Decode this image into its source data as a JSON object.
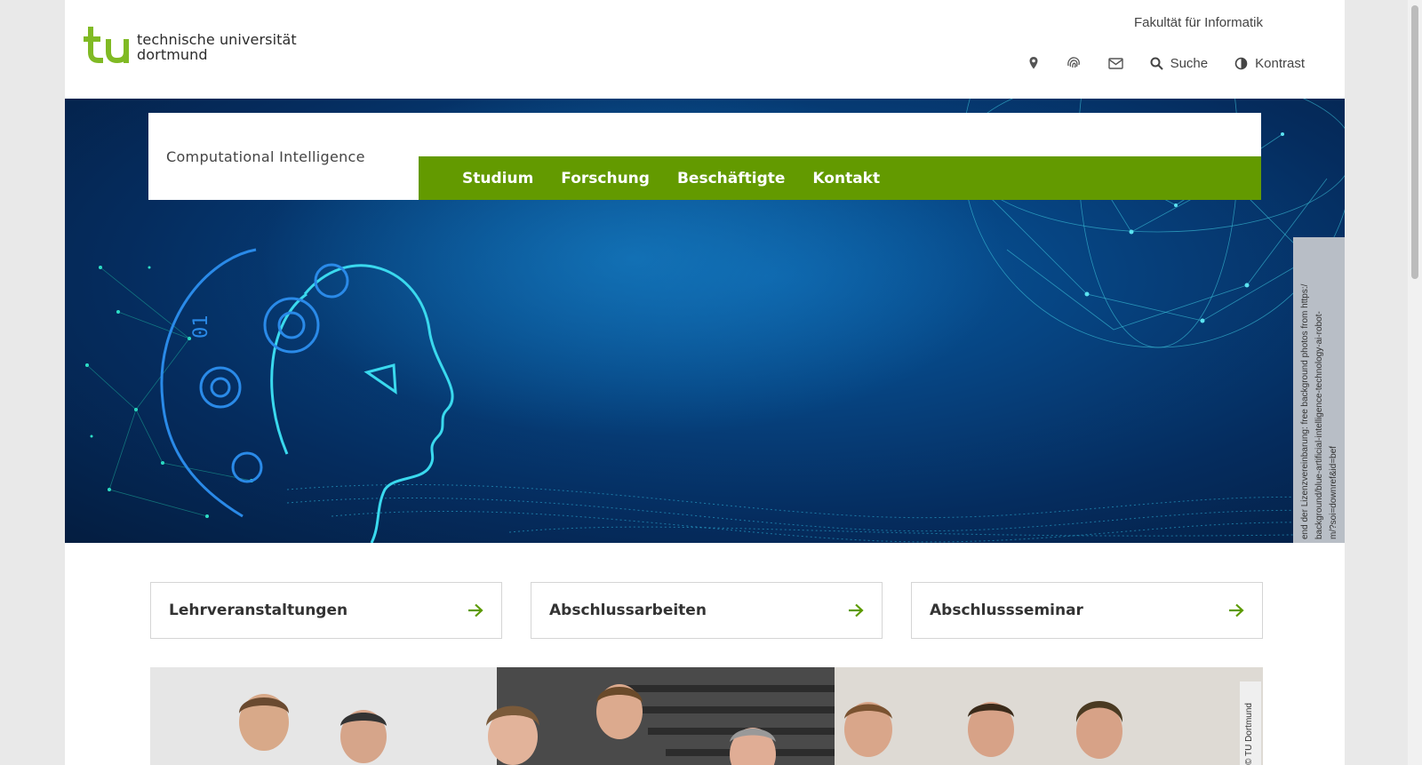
{
  "header": {
    "logo": {
      "line1": "technische universität",
      "line2": "dortmund",
      "mark": "tu"
    },
    "faculty_link": "Fakultät für Informatik",
    "utilities": [
      {
        "icon": "map-pin-icon",
        "label": ""
      },
      {
        "icon": "fingerprint-icon",
        "label": ""
      },
      {
        "icon": "mail-icon",
        "label": ""
      },
      {
        "icon": "search-icon",
        "label": "Suche"
      },
      {
        "icon": "contrast-icon",
        "label": "Kontrast"
      }
    ]
  },
  "hero": {
    "site_title": "Computational Intelligence",
    "nav": [
      "Studium",
      "Forschung",
      "Beschäftigte",
      "Kontakt"
    ],
    "image_credit_lines": [
      "end der Lizenzvereinbarung: free background photos from https:/",
      "background/blue-artificial-intelligence-technology-ai-robot-",
      "m/?soi=downref&id=bef"
    ]
  },
  "quicklinks": [
    "Lehrveranstaltungen",
    "Abschlussarbeiten",
    "Abschlussseminar"
  ],
  "photo": {
    "credit": "© TU Dortmund"
  },
  "colors": {
    "brand_green": "#639a00",
    "hero_blue": "#064583",
    "accent_cyan": "#38d5e6"
  }
}
